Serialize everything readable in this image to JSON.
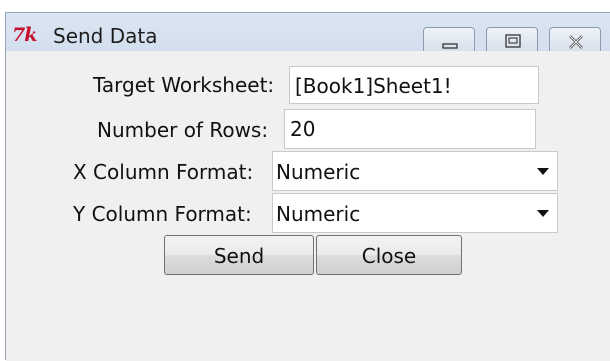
{
  "window": {
    "title": "Send Data",
    "icon": "tk-logo-icon",
    "icon_text": "7k"
  },
  "form": {
    "target_worksheet_label": "Target Worksheet:",
    "target_worksheet_value": "[Book1]Sheet1!",
    "rows_label": "Number of Rows:",
    "rows_value": "20",
    "x_format_label": "X Column Format:",
    "x_format_value": "Numeric",
    "y_format_label": "Y Column Format:",
    "y_format_value": "Numeric"
  },
  "buttons": {
    "send": "Send",
    "close": "Close"
  },
  "colors": {
    "titlebar": "#d6e2f0",
    "tk_logo": "#c8102e",
    "background": "#f0f0f0"
  }
}
